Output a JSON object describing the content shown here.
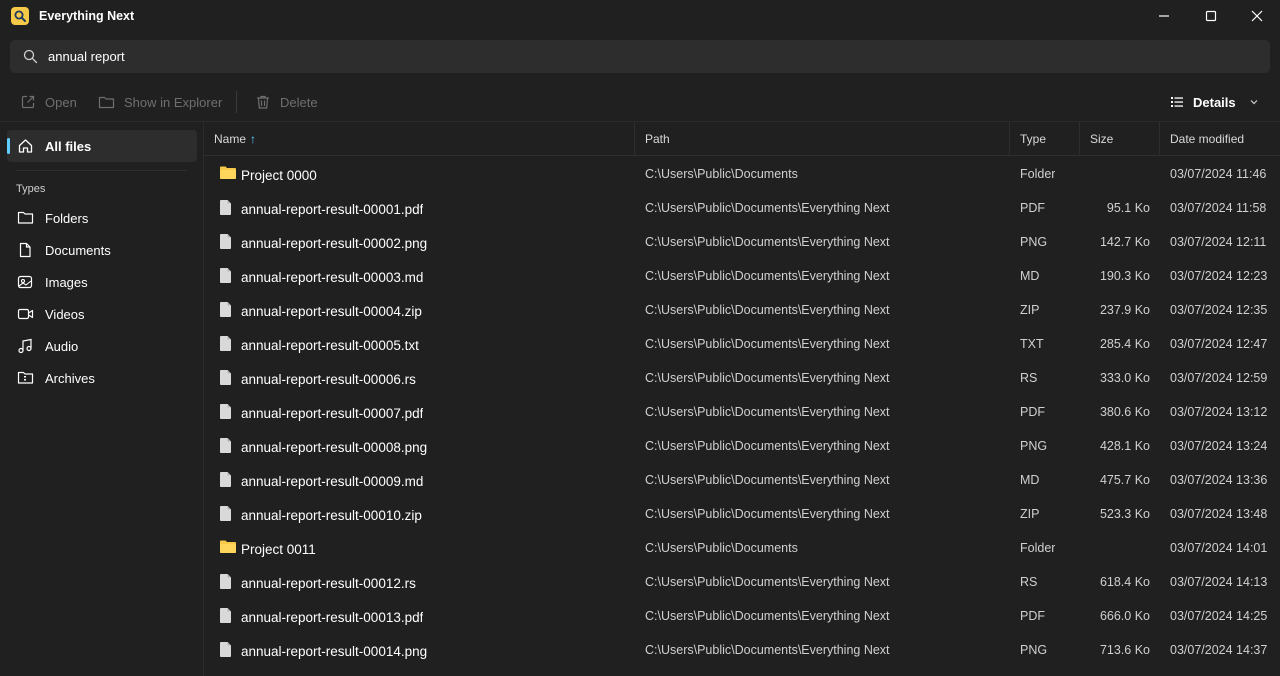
{
  "app": {
    "title": "Everything Next"
  },
  "search": {
    "value": "annual report",
    "icon": "search-icon"
  },
  "toolbar": {
    "open_label": "Open",
    "explorer_label": "Show in Explorer",
    "delete_label": "Delete",
    "view_label": "Details"
  },
  "sidebar": {
    "all_files": "All files",
    "types_heading": "Types",
    "items": [
      {
        "label": "Folders",
        "icon": "folder-icon"
      },
      {
        "label": "Documents",
        "icon": "document-icon"
      },
      {
        "label": "Images",
        "icon": "image-icon"
      },
      {
        "label": "Videos",
        "icon": "video-icon"
      },
      {
        "label": "Audio",
        "icon": "audio-icon"
      },
      {
        "label": "Archives",
        "icon": "archive-icon"
      }
    ]
  },
  "table": {
    "columns": {
      "name": "Name",
      "sort_indicator": "↑",
      "path": "Path",
      "type": "Type",
      "size": "Size",
      "date": "Date modified"
    },
    "rows": [
      {
        "kind": "folder",
        "name": "Project 0000",
        "path": "C:\\Users\\Public\\Documents",
        "type": "Folder",
        "size": "",
        "date": "03/07/2024 11:46"
      },
      {
        "kind": "file",
        "name": "annual-report-result-00001.pdf",
        "path": "C:\\Users\\Public\\Documents\\Everything Next",
        "type": "PDF",
        "size": "95.1 Ko",
        "date": "03/07/2024 11:58"
      },
      {
        "kind": "file",
        "name": "annual-report-result-00002.png",
        "path": "C:\\Users\\Public\\Documents\\Everything Next",
        "type": "PNG",
        "size": "142.7 Ko",
        "date": "03/07/2024 12:11"
      },
      {
        "kind": "file",
        "name": "annual-report-result-00003.md",
        "path": "C:\\Users\\Public\\Documents\\Everything Next",
        "type": "MD",
        "size": "190.3 Ko",
        "date": "03/07/2024 12:23"
      },
      {
        "kind": "file",
        "name": "annual-report-result-00004.zip",
        "path": "C:\\Users\\Public\\Documents\\Everything Next",
        "type": "ZIP",
        "size": "237.9 Ko",
        "date": "03/07/2024 12:35"
      },
      {
        "kind": "file",
        "name": "annual-report-result-00005.txt",
        "path": "C:\\Users\\Public\\Documents\\Everything Next",
        "type": "TXT",
        "size": "285.4 Ko",
        "date": "03/07/2024 12:47"
      },
      {
        "kind": "file",
        "name": "annual-report-result-00006.rs",
        "path": "C:\\Users\\Public\\Documents\\Everything Next",
        "type": "RS",
        "size": "333.0 Ko",
        "date": "03/07/2024 12:59"
      },
      {
        "kind": "file",
        "name": "annual-report-result-00007.pdf",
        "path": "C:\\Users\\Public\\Documents\\Everything Next",
        "type": "PDF",
        "size": "380.6 Ko",
        "date": "03/07/2024 13:12"
      },
      {
        "kind": "file",
        "name": "annual-report-result-00008.png",
        "path": "C:\\Users\\Public\\Documents\\Everything Next",
        "type": "PNG",
        "size": "428.1 Ko",
        "date": "03/07/2024 13:24"
      },
      {
        "kind": "file",
        "name": "annual-report-result-00009.md",
        "path": "C:\\Users\\Public\\Documents\\Everything Next",
        "type": "MD",
        "size": "475.7 Ko",
        "date": "03/07/2024 13:36"
      },
      {
        "kind": "file",
        "name": "annual-report-result-00010.zip",
        "path": "C:\\Users\\Public\\Documents\\Everything Next",
        "type": "ZIP",
        "size": "523.3 Ko",
        "date": "03/07/2024 13:48"
      },
      {
        "kind": "folder",
        "name": "Project 0011",
        "path": "C:\\Users\\Public\\Documents",
        "type": "Folder",
        "size": "",
        "date": "03/07/2024 14:01"
      },
      {
        "kind": "file",
        "name": "annual-report-result-00012.rs",
        "path": "C:\\Users\\Public\\Documents\\Everything Next",
        "type": "RS",
        "size": "618.4 Ko",
        "date": "03/07/2024 14:13"
      },
      {
        "kind": "file",
        "name": "annual-report-result-00013.pdf",
        "path": "C:\\Users\\Public\\Documents\\Everything Next",
        "type": "PDF",
        "size": "666.0 Ko",
        "date": "03/07/2024 14:25"
      },
      {
        "kind": "file",
        "name": "annual-report-result-00014.png",
        "path": "C:\\Users\\Public\\Documents\\Everything Next",
        "type": "PNG",
        "size": "713.6 Ko",
        "date": "03/07/2024 14:37"
      }
    ]
  },
  "colors": {
    "background": "#202020",
    "accent": "#60cdff",
    "folder": "#f7c948",
    "surface": "#2d2d2d"
  }
}
